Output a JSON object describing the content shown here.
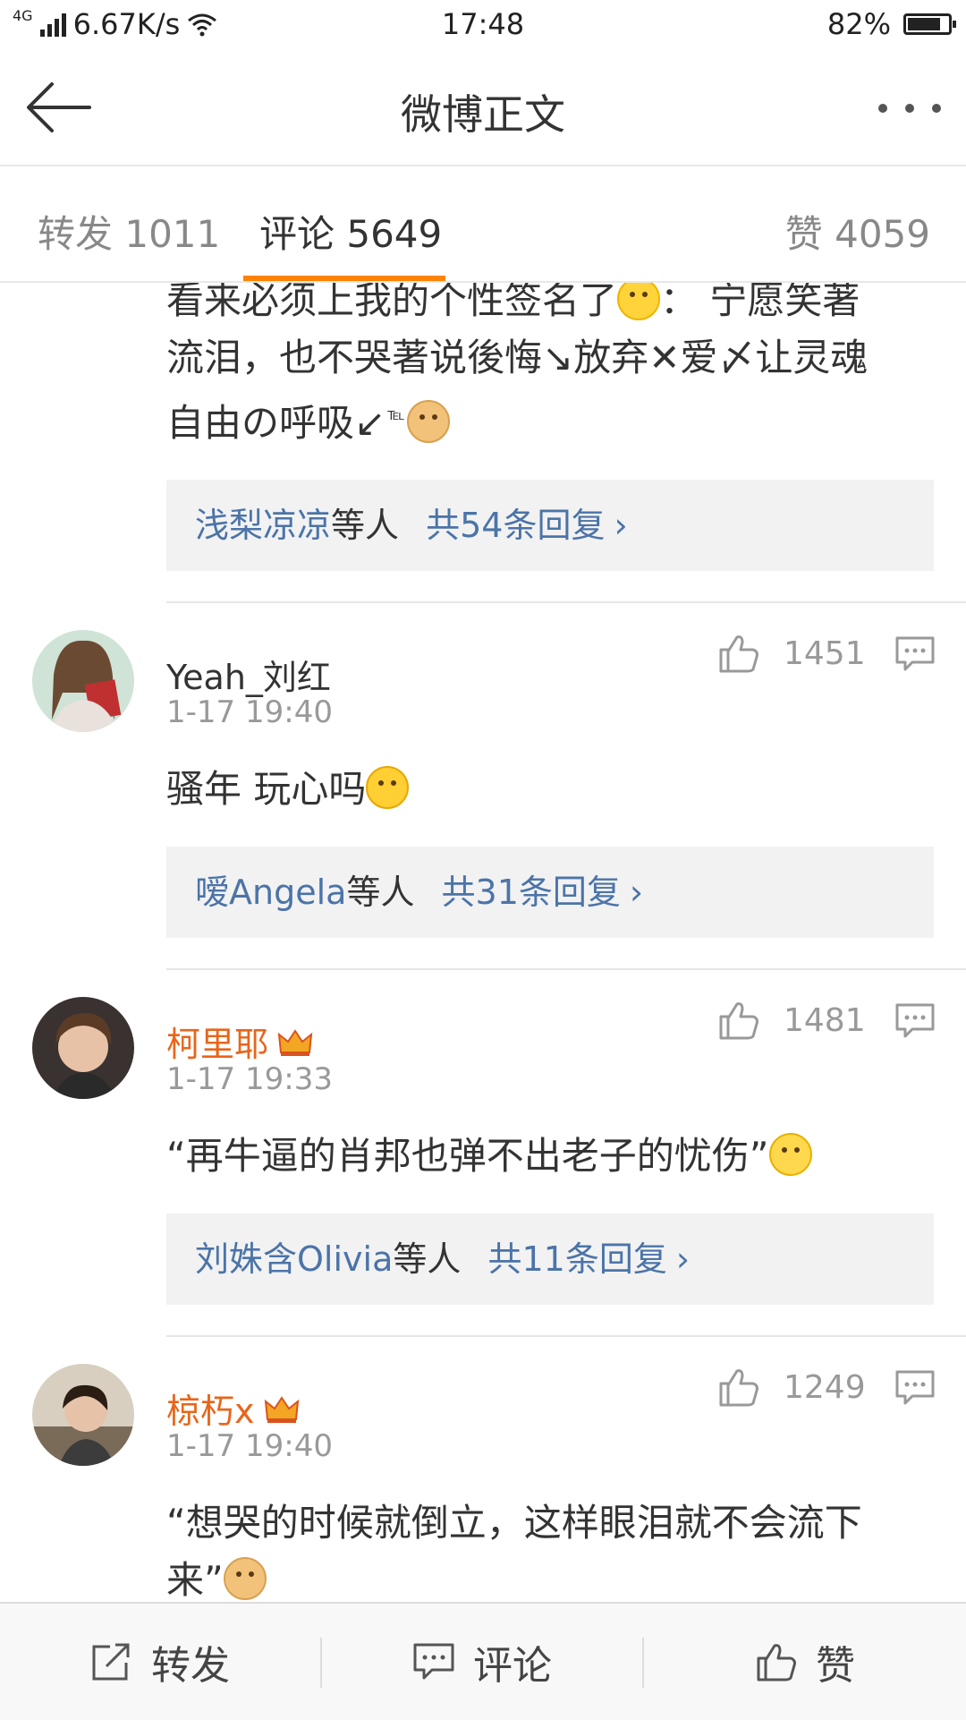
{
  "status_bar": {
    "network": "4G",
    "speed": "6.67K/s",
    "time": "17:48",
    "battery": "82%",
    "battery_level": 0.82
  },
  "nav": {
    "title": "微博正文"
  },
  "tabs": [
    {
      "label": "转发 1011"
    },
    {
      "label": "评论 5649"
    },
    {
      "label": "赞 4059"
    }
  ],
  "comments": [
    {
      "text_lines": [
        "看来必须上我的个性签名了",
        "：  宁愿笑著",
        "流泪，也不哭著说後悔↘放弃✕爱〆让灵魂",
        "自由の呼吸↙",
        "℡"
      ],
      "reply_box": {
        "names": "浅梨凉凉",
        "suffix": "等人",
        "count_text": "共54条回复",
        "chevron": "›"
      }
    },
    {
      "username": "Yeah_刘红",
      "time": "1-17 19:40",
      "likes": "1451",
      "text": "骚年 玩心吗",
      "reply_box": {
        "names": "嗳Angela",
        "suffix": "等人",
        "count_text": "共31条回复",
        "chevron": "›"
      }
    },
    {
      "username": "柯里耶",
      "time": "1-17 19:33",
      "likes": "1481",
      "text": "“再牛逼的肖邦也弹不出老子的忧伤”",
      "reply_box": {
        "names": "刘姝含Olivia",
        "suffix": "等人",
        "count_text": "共11条回复",
        "chevron": "›"
      }
    },
    {
      "username": "椋朽x",
      "time": "1-17 19:40",
      "likes": "1249",
      "text_lines": [
        "“想哭的时候就倒立，这样眼泪就不会流下",
        "来”"
      ]
    }
  ],
  "bottom_bar": {
    "repost": "转发",
    "comment": "评论",
    "like": "赞"
  },
  "colors": {
    "accent_orange": "#ff8200",
    "vip_name": "#e8651a",
    "link_blue": "#4b74a8",
    "reply_bg": "#f2f2f2"
  }
}
